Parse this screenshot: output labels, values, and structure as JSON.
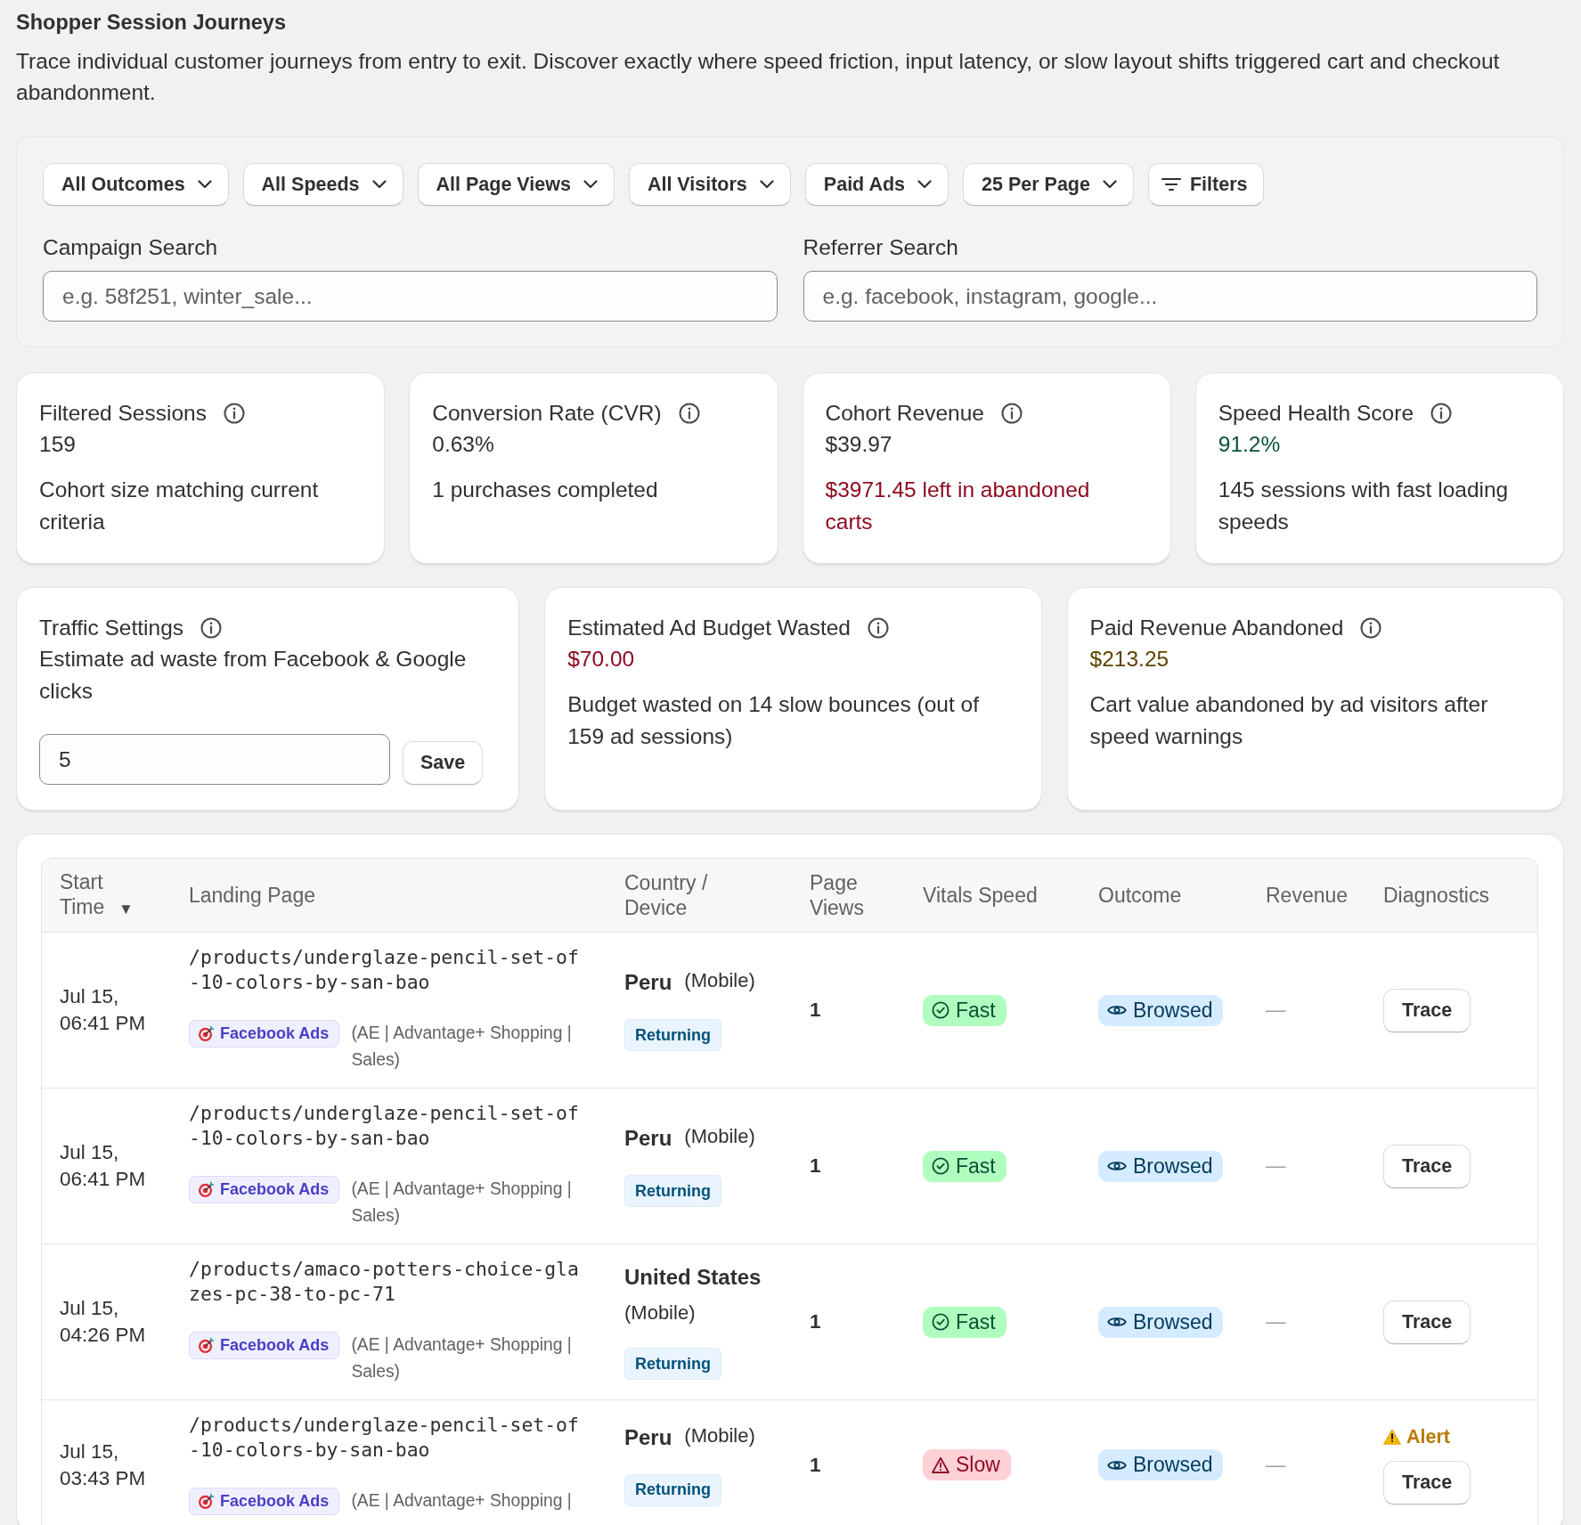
{
  "page": {
    "title": "Shopper Session Journeys",
    "description": "Trace individual customer journeys from entry to exit. Discover exactly where speed friction, input latency, or slow layout shifts triggered cart and checkout abandonment."
  },
  "filters": {
    "dropdowns": [
      {
        "label": "All Outcomes"
      },
      {
        "label": "All Speeds"
      },
      {
        "label": "All Page Views"
      },
      {
        "label": "All Visitors"
      },
      {
        "label": "Paid Ads"
      },
      {
        "label": "25 Per Page"
      }
    ],
    "more_button": {
      "label": "Filters"
    },
    "searches": [
      {
        "label": "Campaign Search",
        "placeholder": "e.g. 58f251, winter_sale..."
      },
      {
        "label": "Referrer Search",
        "placeholder": "e.g. facebook, instagram, google..."
      }
    ]
  },
  "summary_cards": [
    {
      "title": "Filtered Sessions",
      "value": {
        "text": "159",
        "color": "#303030"
      },
      "note": {
        "text": "Cohort size matching current criteria",
        "color": "#303030"
      }
    },
    {
      "title": "Conversion Rate (CVR)",
      "value": {
        "text": "0.63%",
        "color": "#303030"
      },
      "note": {
        "text": "1 purchases completed",
        "color": "#303030"
      }
    },
    {
      "title": "Cohort Revenue",
      "value": {
        "text": "$39.97",
        "color": "#303030"
      },
      "note": {
        "text": "$3971.45 left in abandoned carts",
        "color": "#8e0b21"
      }
    },
    {
      "title": "Speed Health Score",
      "value": {
        "text": "91.2%",
        "color": "#0c5132"
      },
      "note": {
        "text": "145 sessions with fast loading speeds",
        "color": "#303030"
      }
    }
  ],
  "ad_cards": [
    {
      "kind": "settings",
      "title": "Traffic Settings",
      "description": "Estimate ad waste from Facebook & Google clicks",
      "input_value": "5",
      "button": "Save"
    },
    {
      "kind": "metric",
      "title": "Estimated Ad Budget Wasted",
      "value": {
        "text": "$70.00",
        "color": "#8e0b21"
      },
      "note": "Budget wasted on 14 slow bounces (out of 159 ad sessions)"
    },
    {
      "kind": "metric",
      "title": "Paid Revenue Abandoned",
      "value": {
        "text": "$213.25",
        "color": "#5e4200"
      },
      "note": "Cart value abandoned by ad visitors after speed warnings"
    }
  ],
  "sessions_table": {
    "columns": [
      {
        "label": "Start Time",
        "sort_mark": "▼"
      },
      {
        "label": "Landing Page"
      },
      {
        "label": "Country / Device"
      },
      {
        "label": "Page Views"
      },
      {
        "label": "Vitals Speed"
      },
      {
        "label": "Outcome"
      },
      {
        "label": "Revenue"
      },
      {
        "label": "Diagnostics"
      }
    ],
    "rows": [
      {
        "start_time": "Jul 15, 06:41 PM",
        "landing_page": "/products/underglaze-pencil-set-of-10-colors-by-san-bao",
        "source": "Facebook Ads",
        "campaign": "(AE | Advantage+ Shopping | Sales)",
        "country": "Peru",
        "device": "(Mobile)",
        "visitor": "Returning",
        "page_views": "1",
        "speed": {
          "kind": "fast",
          "label": "Fast"
        },
        "outcome": {
          "kind": "browsed",
          "label": "Browsed"
        },
        "revenue": "—",
        "action": "Trace"
      },
      {
        "start_time": "Jul 15, 06:41 PM",
        "landing_page": "/products/underglaze-pencil-set-of-10-colors-by-san-bao",
        "source": "Facebook Ads",
        "campaign": "(AE | Advantage+ Shopping | Sales)",
        "country": "Peru",
        "device": "(Mobile)",
        "visitor": "Returning",
        "page_views": "1",
        "speed": {
          "kind": "fast",
          "label": "Fast"
        },
        "outcome": {
          "kind": "browsed",
          "label": "Browsed"
        },
        "revenue": "—",
        "action": "Trace"
      },
      {
        "start_time": "Jul 15, 04:26 PM",
        "landing_page": "/products/amaco-potters-choice-glazes-pc-38-to-pc-71",
        "source": "Facebook Ads",
        "campaign": "(AE | Advantage+ Shopping | Sales)",
        "country": "United States",
        "device": "(Mobile)",
        "visitor": "Returning",
        "page_views": "1",
        "speed": {
          "kind": "fast",
          "label": "Fast"
        },
        "outcome": {
          "kind": "browsed",
          "label": "Browsed"
        },
        "revenue": "—",
        "action": "Trace"
      },
      {
        "start_time": "Jul 15, 03:43 PM",
        "landing_page": "/products/underglaze-pencil-set-of-10-colors-by-san-bao",
        "source": "Facebook Ads",
        "campaign": "(AE | Advantage+ Shopping |",
        "country": "Peru",
        "device": "(Mobile)",
        "visitor": "Returning",
        "page_views": "1",
        "speed": {
          "kind": "slow",
          "label": "Slow"
        },
        "outcome": {
          "kind": "browsed",
          "label": "Browsed"
        },
        "revenue": "—",
        "alert": "Alert",
        "action": "Trace"
      }
    ]
  }
}
